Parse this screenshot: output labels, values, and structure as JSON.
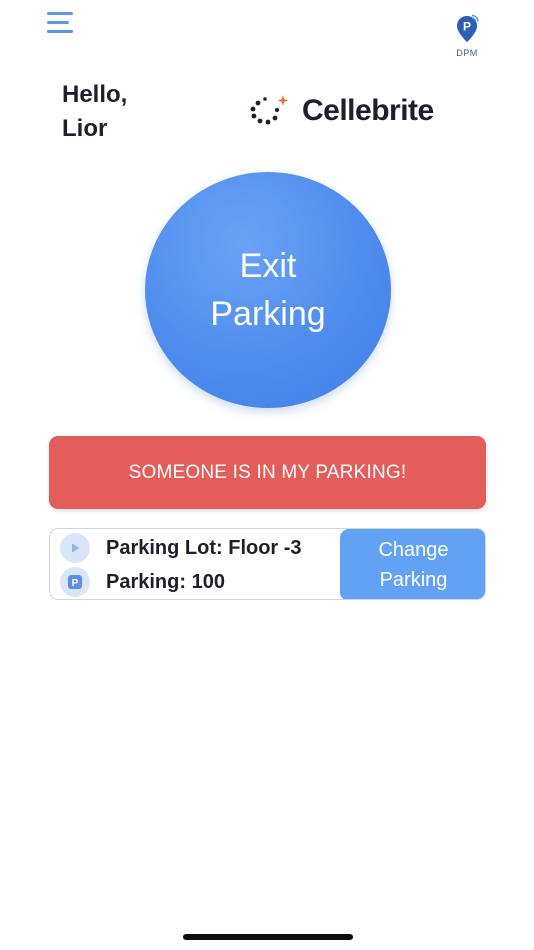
{
  "header": {
    "menu_icon": "hamburger-menu-icon",
    "app_logo_icon": "dpm-parking-pin-icon",
    "app_logo_text": "DPM"
  },
  "greeting": {
    "line1": "Hello,",
    "line2": "Lior"
  },
  "company": {
    "logo_icon": "cellebrite-dots-icon",
    "name": "Cellebrite"
  },
  "exit_button": {
    "label": "Exit Parking"
  },
  "alert_button": {
    "label": "SOMEONE IS IN MY PARKING!"
  },
  "parking_info": {
    "lot_icon": "play-triangle-icon",
    "lot_label": "Parking Lot: Floor -3",
    "spot_icon": "parking-p-icon",
    "spot_label": "Parking: 100",
    "change_label": "Change Parking"
  },
  "colors": {
    "primary": "#4e8ced",
    "alert": "#e35d5b",
    "change_button": "#62a2f4",
    "icon_bg": "#d9e6fa"
  }
}
